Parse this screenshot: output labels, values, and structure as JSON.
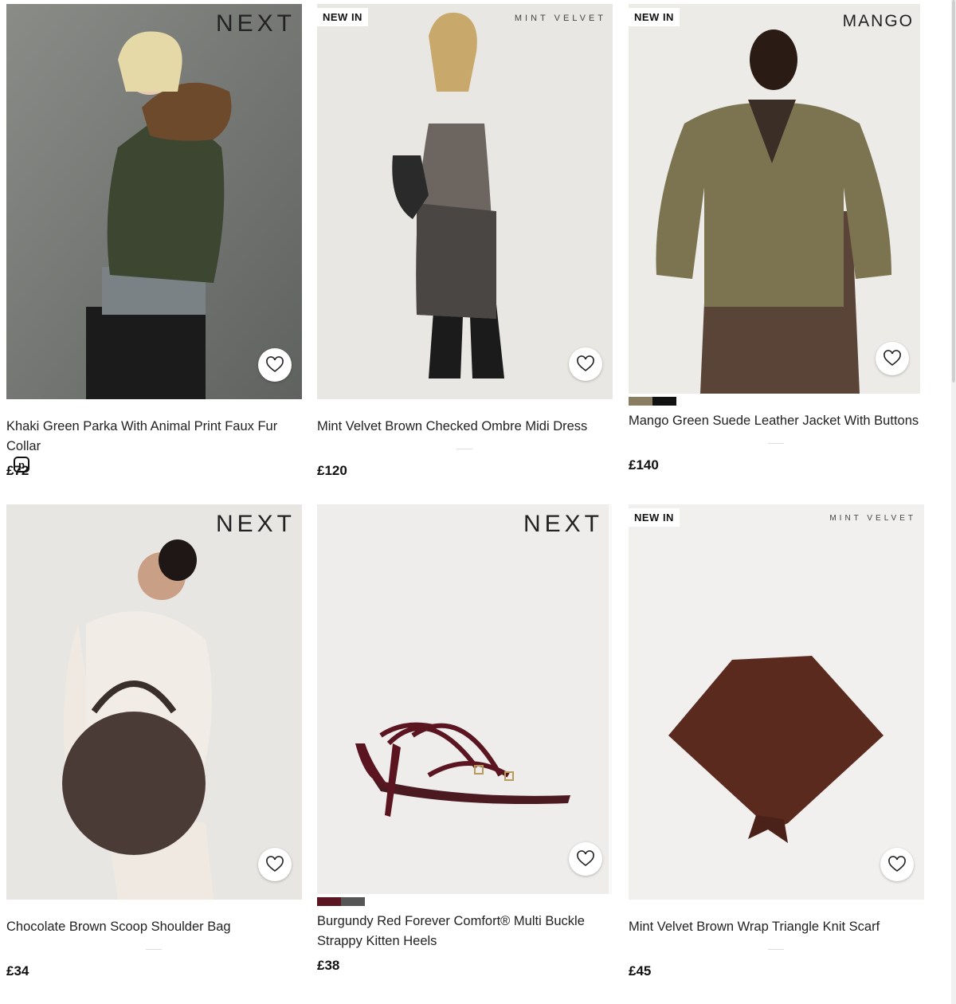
{
  "products": [
    {
      "brand": "NEXT",
      "new_in": "",
      "title": "Khaki Green Parka With Animal Print Faux Fur Collar",
      "price": "£72",
      "badge": "p"
    },
    {
      "brand": "MINT VELVET",
      "new_in": "NEW IN",
      "title": "Mint Velvet Brown Checked Ombre Midi Dress",
      "price": "£120"
    },
    {
      "brand": "MANGO",
      "new_in": "NEW IN",
      "title": "Mango Green Suede Leather Jacket With Buttons",
      "price": "£140",
      "swatches": [
        "#8a7d62",
        "#6b4a3a",
        "#111111"
      ]
    },
    {
      "brand": "NEXT",
      "new_in": "",
      "title": "Chocolate Brown Scoop Shoulder Bag",
      "price": "£34"
    },
    {
      "brand": "NEXT",
      "new_in": "",
      "title": "Burgundy Red Forever Comfort® Multi Buckle Strappy Kitten Heels",
      "price": "£38",
      "swatches": [
        "#5a1520",
        "#111111",
        "#555555"
      ]
    },
    {
      "brand": "MINT VELVET",
      "new_in": "NEW IN",
      "title": "Mint Velvet Brown Wrap Triangle Knit Scarf",
      "price": "£45"
    }
  ]
}
